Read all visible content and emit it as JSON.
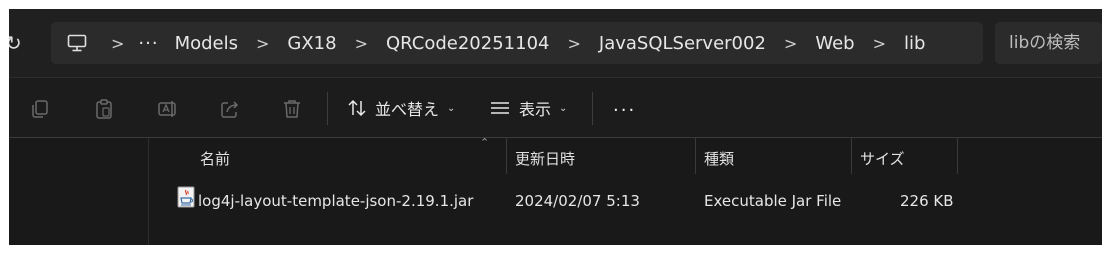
{
  "address_bar": {
    "breadcrumbs": [
      "Models",
      "GX18",
      "QRCode20251104",
      "JavaSQLServer002",
      "Web",
      "lib"
    ],
    "overflow": "···",
    "separator": ">",
    "search_placeholder": "libの検索"
  },
  "toolbar": {
    "sort_label": "並べ替え",
    "view_label": "表示",
    "more_label": "···",
    "icons": [
      "copy-icon",
      "paste-icon",
      "rename-icon",
      "share-icon",
      "delete-icon",
      "sort-icon",
      "view-icon"
    ]
  },
  "file_list": {
    "columns": [
      "名前",
      "更新日時",
      "種類",
      "サイズ"
    ],
    "rows": [
      {
        "name": "log4j-layout-template-json-2.19.1.jar",
        "modified": "2024/02/07 5:13",
        "type": "Executable Jar File",
        "size": "226 KB"
      }
    ]
  },
  "colors": {
    "window_bg": "#1c1c1c",
    "address_bg": "#2b2b2b",
    "text": "#e6e6e6"
  }
}
